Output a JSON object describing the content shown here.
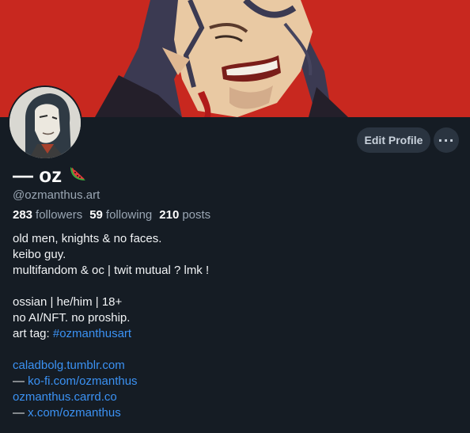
{
  "profile": {
    "display_name": "— oz",
    "name_emoji": "watermelon-icon",
    "handle": "@ozmanthus.art",
    "edit_label": "Edit Profile",
    "more_label": "···"
  },
  "stats": {
    "followers_count": "283",
    "followers_label": "followers",
    "following_count": "59",
    "following_label": "following",
    "posts_count": "210",
    "posts_label": "posts"
  },
  "bio": {
    "line1": "old men, knights & no faces.",
    "line2": "keibo guy.",
    "line3": "multifandom & oc | twit mutual ? lmk !",
    "line5": "ossian | he/him | 18+",
    "line6": "no AI/NFT. no proship.",
    "line7_prefix": "art tag: ",
    "line7_tag": "#ozmanthusart",
    "link1": "caladbolg.tumblr.com",
    "link2_prefix": "— ",
    "link2": "ko-fi.com/ozmanthus",
    "link3": "ozmanthus.carrd.co",
    "link4_prefix": "— ",
    "link4": "x.com/ozmanthus"
  },
  "colors": {
    "banner_red": "#c8281f",
    "background": "#151c24",
    "link_blue": "#3b92f4",
    "muted_text": "#9aa6b3"
  }
}
